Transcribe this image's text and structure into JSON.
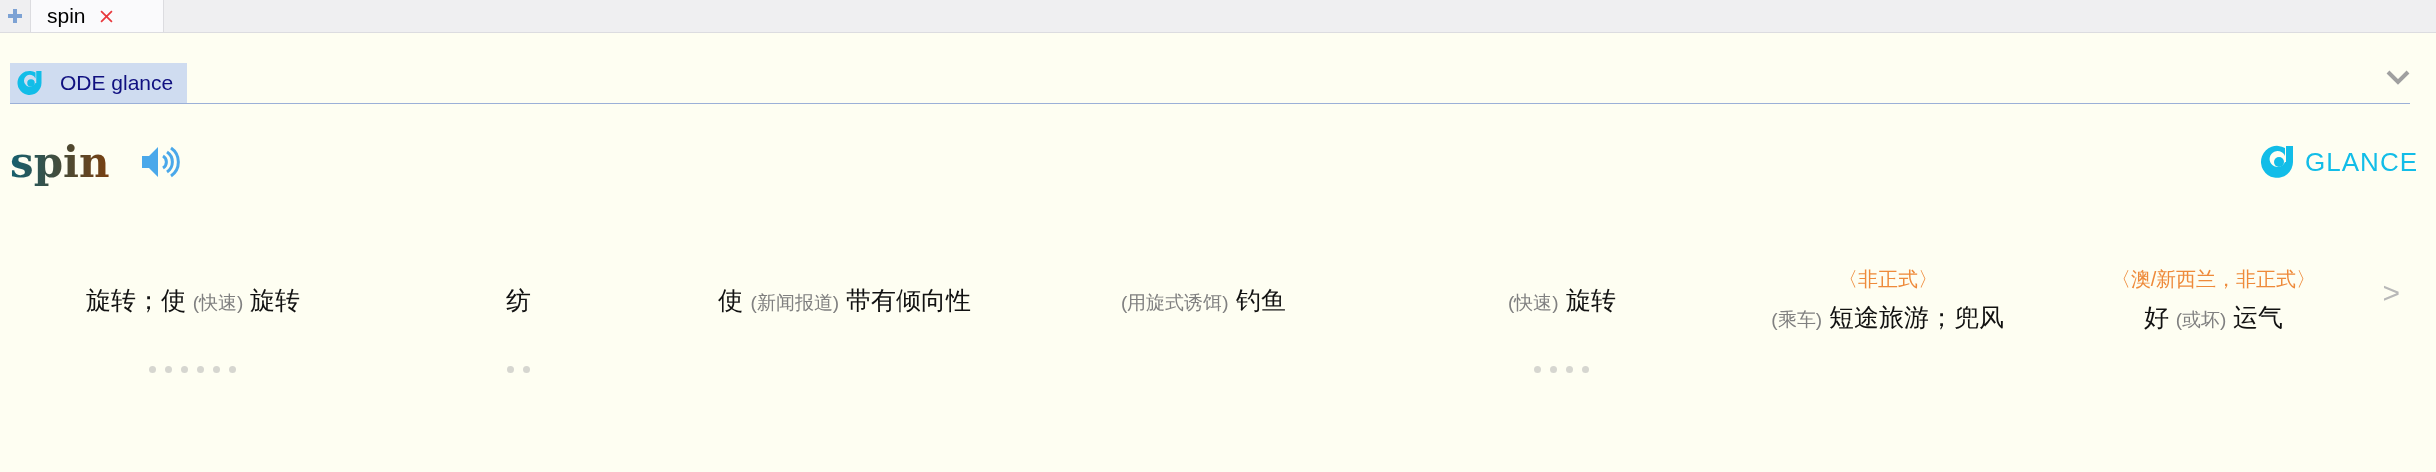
{
  "tabs": [
    {
      "label": "spin",
      "selected": true
    }
  ],
  "section": {
    "title": "ODE glance",
    "expanded": true
  },
  "entry": {
    "headword": "spin",
    "brand": "GLANCE"
  },
  "senses": [
    {
      "parts": [
        {
          "kind": "text",
          "text": "旋转；使"
        },
        {
          "kind": "note",
          "text": "(快速)"
        },
        {
          "kind": "text",
          "text": "旋转"
        }
      ],
      "pager": [
        {
          "selected": false
        },
        {
          "selected": false
        },
        {
          "selected": false
        },
        {
          "selected": false
        },
        {
          "selected": false
        },
        {
          "selected": false
        }
      ]
    },
    {
      "parts": [
        {
          "kind": "text",
          "text": "纺"
        }
      ],
      "pager": [
        {
          "selected": false
        },
        {
          "selected": false
        }
      ]
    },
    {
      "parts": [
        {
          "kind": "text",
          "text": "使"
        },
        {
          "kind": "note",
          "text": "(新闻报道)"
        },
        {
          "kind": "text",
          "text": "带有倾向性"
        }
      ]
    },
    {
      "parts": [
        {
          "kind": "note",
          "text": "(用旋式诱饵)"
        },
        {
          "kind": "text",
          "text": "钓鱼"
        }
      ]
    },
    {
      "parts": [
        {
          "kind": "note",
          "text": "(快速)"
        },
        {
          "kind": "text",
          "text": "旋转"
        }
      ],
      "pager": [
        {
          "selected": false
        },
        {
          "selected": false
        },
        {
          "selected": false
        },
        {
          "selected": false
        }
      ]
    },
    {
      "register": "〈非正式〉",
      "parts": [
        {
          "kind": "note",
          "text": "(乘车)"
        },
        {
          "kind": "text",
          "text": "短途旅游；兜风"
        }
      ]
    },
    {
      "register": "〈澳/新西兰，非正式〉",
      "parts": [
        {
          "kind": "text",
          "text": "好"
        },
        {
          "kind": "note",
          "text": "(或坏)"
        },
        {
          "kind": "text",
          "text": "运气"
        }
      ]
    }
  ],
  "next": ">"
}
